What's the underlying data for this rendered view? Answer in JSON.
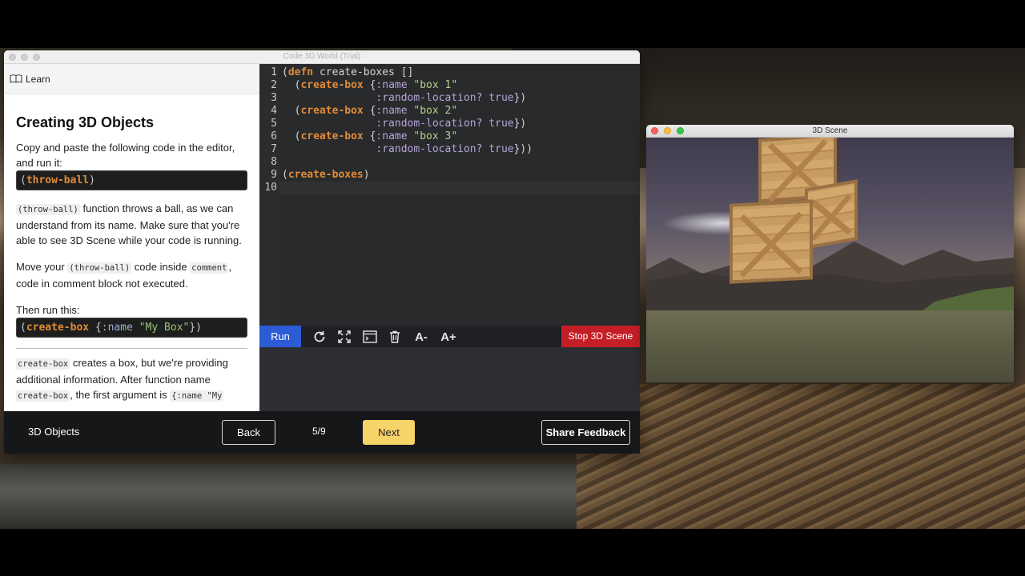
{
  "app": {
    "window_title": "Code 3D World (Trial)"
  },
  "learn": {
    "header_label": "Learn",
    "title": "Creating 3D Objects",
    "p1": "Copy and paste the following code in the editor, and run it:",
    "snippet1": "throw-ball",
    "p2_code": "(throw-ball)",
    "p2_text": " function throws a ball, as we can understand from its name. Make sure that you're able to see 3D Scene while your code is running.",
    "p3_prefix": "Move your ",
    "p3_code1": "(throw-ball)",
    "p3_mid": " code inside ",
    "p3_code2": "comment",
    "p3_suffix": ", code in comment block not executed.",
    "p4": "Then run this:",
    "snippet2": {
      "fn": "create-box",
      "kw": ":name",
      "str": "\"My Box\""
    },
    "p5_code1": "create-box",
    "p5_text1": " creates a box, but we're providing additional information. After function name ",
    "p5_code2": "create-box",
    "p5_text2": ", the first argument is ",
    "p5_code3": "{:name \"My"
  },
  "editor": {
    "line_numbers": [
      "1",
      "2",
      "3",
      "4",
      "5",
      "6",
      "7",
      "8",
      "9",
      "10"
    ],
    "lines": [
      "(defn create-boxes []",
      "  (create-box {:name \"box 1\"",
      "               :random-location? true})",
      "  (create-box {:name \"box 2\"",
      "               :random-location? true})",
      "  (create-box {:name \"box 3\"",
      "               :random-location? true}))",
      "",
      "(create-boxes)",
      ""
    ]
  },
  "toolbar": {
    "run_label": "Run",
    "font_decrease_label": "A-",
    "font_increase_label": "A+",
    "stop_label": "Stop 3D Scene"
  },
  "bottom": {
    "chapter": "3D Objects",
    "back_label": "Back",
    "pager": "5/9",
    "next_label": "Next",
    "feedback_label": "Share Feedback"
  },
  "scene": {
    "window_title": "3D Scene"
  },
  "colors": {
    "run": "#2d5bd6",
    "stop": "#c41f26",
    "next": "#f7d467",
    "keyword": "#e08b3a",
    "string": "#b5cf8a"
  }
}
